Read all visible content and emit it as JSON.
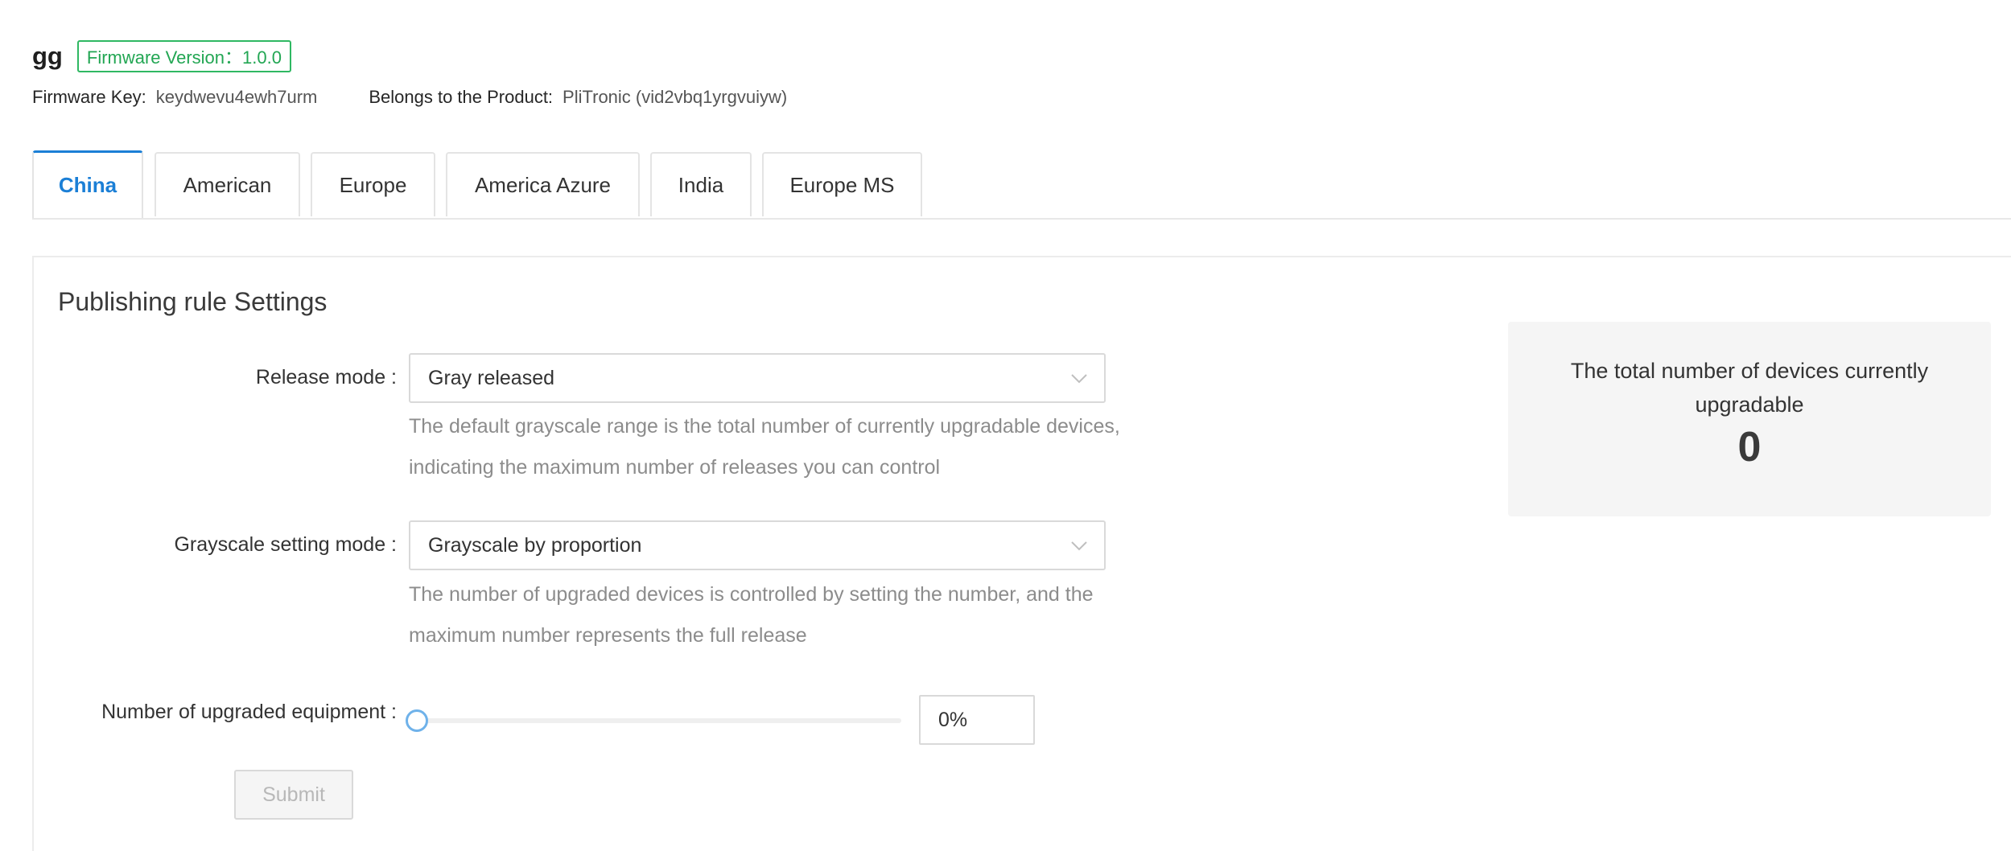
{
  "header": {
    "title": "gg",
    "version_tag": "Firmware Version：1.0.0",
    "firmware_key_label": "Firmware Key:",
    "firmware_key_value": "keydwevu4ewh7urm",
    "product_label": "Belongs to the Product:",
    "product_value": "PliTronic (vid2vbq1yrgvuiyw)"
  },
  "tabs": [
    {
      "label": "China",
      "active": true
    },
    {
      "label": "American",
      "active": false
    },
    {
      "label": "Europe",
      "active": false
    },
    {
      "label": "America Azure",
      "active": false
    },
    {
      "label": "India",
      "active": false
    },
    {
      "label": "Europe MS",
      "active": false
    }
  ],
  "panel": {
    "title": "Publishing rule Settings",
    "release_mode": {
      "label": "Release mode :",
      "value": "Gray released",
      "help": "The default grayscale range is the total number of currently upgradable devices, indicating the maximum number of releases you can control"
    },
    "grayscale_mode": {
      "label": "Grayscale setting mode :",
      "value": "Grayscale by proportion",
      "help": "The number of upgraded devices is controlled by setting the number, and the maximum number represents the full release"
    },
    "upgraded_equipment": {
      "label": "Number of upgraded equipment :",
      "slider_percent": 0,
      "input_value": "0%"
    },
    "submit_label": "Submit"
  },
  "stats": {
    "label": "The total number of devices currently upgradable",
    "value": "0"
  },
  "colors": {
    "accent": "#1b7fd6",
    "tag_green": "#22a653",
    "help_text": "#8c8c8c",
    "card_bg": "#f5f5f5"
  }
}
